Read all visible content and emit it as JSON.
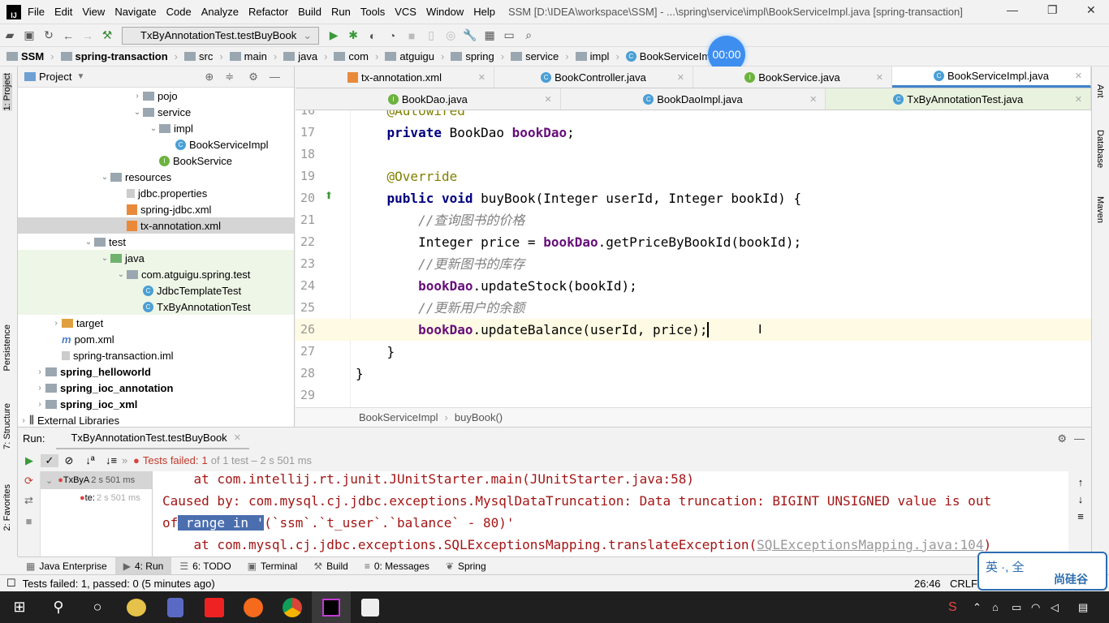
{
  "window": {
    "title": "SSM [D:\\IDEA\\workspace\\SSM] - ...\\spring\\service\\impl\\BookServiceImpl.java [spring-transaction]"
  },
  "menu": [
    "File",
    "Edit",
    "View",
    "Navigate",
    "Code",
    "Analyze",
    "Refactor",
    "Build",
    "Run",
    "Tools",
    "VCS",
    "Window",
    "Help"
  ],
  "toolbar": {
    "run_config": "TxByAnnotationTest.testBuyBook"
  },
  "breadcrumb": [
    "SSM",
    "spring-transaction",
    "src",
    "main",
    "java",
    "com",
    "atguigu",
    "spring",
    "service",
    "impl",
    "BookServiceImpl"
  ],
  "timer": "00:00",
  "left_stripe": [
    "1: Project",
    "Persistence",
    "7: Structure",
    "2: Favorites"
  ],
  "right_stripe": [
    "Ant",
    "Database",
    "Maven"
  ],
  "project": {
    "title": "Project",
    "tree": [
      {
        "label": "pojo",
        "indent": 7,
        "arrow": ">",
        "icon": "folder"
      },
      {
        "label": "service",
        "indent": 7,
        "arrow": "v",
        "icon": "folder"
      },
      {
        "label": "impl",
        "indent": 8,
        "arrow": "v",
        "icon": "folder"
      },
      {
        "label": "BookServiceImpl",
        "indent": 9,
        "arrow": "",
        "icon": "class"
      },
      {
        "label": "BookService",
        "indent": 8,
        "arrow": "",
        "icon": "interface"
      },
      {
        "label": "resources",
        "indent": 5,
        "arrow": "v",
        "icon": "folder"
      },
      {
        "label": "jdbc.properties",
        "indent": 6,
        "arrow": "",
        "icon": "file"
      },
      {
        "label": "spring-jdbc.xml",
        "indent": 6,
        "arrow": "",
        "icon": "xml"
      },
      {
        "label": "tx-annotation.xml",
        "indent": 6,
        "arrow": "",
        "icon": "xml",
        "selected": true
      },
      {
        "label": "test",
        "indent": 4,
        "arrow": "v",
        "icon": "folder"
      },
      {
        "label": "java",
        "indent": 5,
        "arrow": "v",
        "icon": "folder-green",
        "test": true
      },
      {
        "label": "com.atguigu.spring.test",
        "indent": 6,
        "arrow": "v",
        "icon": "folder",
        "test": true
      },
      {
        "label": "JdbcTemplateTest",
        "indent": 7,
        "arrow": "",
        "icon": "class",
        "test": true
      },
      {
        "label": "TxByAnnotationTest",
        "indent": 7,
        "arrow": "",
        "icon": "class",
        "test": true
      },
      {
        "label": "target",
        "indent": 2,
        "arrow": ">",
        "icon": "folder-orange"
      },
      {
        "label": "pom.xml",
        "indent": 2,
        "arrow": "",
        "icon": "maven"
      },
      {
        "label": "spring-transaction.iml",
        "indent": 2,
        "arrow": "",
        "icon": "file"
      },
      {
        "label": "spring_helloworld",
        "indent": 1,
        "arrow": ">",
        "icon": "folder",
        "bold": true
      },
      {
        "label": "spring_ioc_annotation",
        "indent": 1,
        "arrow": ">",
        "icon": "folder",
        "bold": true
      },
      {
        "label": "spring_ioc_xml",
        "indent": 1,
        "arrow": ">",
        "icon": "folder",
        "bold": true
      },
      {
        "label": "External Libraries",
        "indent": 0,
        "arrow": ">",
        "icon": "library"
      }
    ]
  },
  "tabs_row1": [
    {
      "label": "tx-annotation.xml",
      "icon": "xml"
    },
    {
      "label": "BookController.java",
      "icon": "class"
    },
    {
      "label": "BookService.java",
      "icon": "interface"
    },
    {
      "label": "BookServiceImpl.java",
      "icon": "class",
      "active": true
    }
  ],
  "tabs_row2": [
    {
      "label": "BookDao.java",
      "icon": "interface"
    },
    {
      "label": "BookDaoImpl.java",
      "icon": "class"
    },
    {
      "label": "TxByAnnotationTest.java",
      "icon": "class",
      "active": true
    }
  ],
  "editor": {
    "lines": [
      {
        "n": "16",
        "html": "    <span class='an'>@Autowired</span>"
      },
      {
        "n": "17",
        "html": "    <span class='kw'>private</span> BookDao <span class='fld'>bookDao</span>;"
      },
      {
        "n": "18",
        "html": ""
      },
      {
        "n": "19",
        "html": "    <span class='an'>@Override</span>"
      },
      {
        "n": "20",
        "html": "    <span class='kw'>public void</span> buyBook(Integer userId, Integer bookId) {"
      },
      {
        "n": "21",
        "html": "        <span class='cm'>//查询图书的价格</span>"
      },
      {
        "n": "22",
        "html": "        Integer price = <span class='fld'>bookDao</span>.getPriceByBookId(bookId);"
      },
      {
        "n": "23",
        "html": "        <span class='cm'>//更新图书的库存</span>"
      },
      {
        "n": "24",
        "html": "        <span class='fld'>bookDao</span>.updateStock(bookId);"
      },
      {
        "n": "25",
        "html": "        <span class='cm'>//更新用户的余额</span>"
      },
      {
        "n": "26",
        "html": "        <span class='fld'>bookDao</span>.updateBalance(userId, price);",
        "current": true
      },
      {
        "n": "27",
        "html": "    }"
      },
      {
        "n": "28",
        "html": "}"
      },
      {
        "n": "29",
        "html": ""
      }
    ],
    "breadcrumb": [
      "BookServiceImpl",
      "buyBook()"
    ]
  },
  "run": {
    "label": "Run:",
    "tab": "TxByAnnotationTest.testBuyBook",
    "status_prefix": "Tests failed:",
    "status_count": "1",
    "status_suffix": "of 1 test – 2 s 501 ms",
    "tree": [
      {
        "label": "TxByA",
        "time": "2 s 501 ms"
      },
      {
        "label": "te:",
        "time": "2 s 501 ms"
      }
    ],
    "console": {
      "l1": "    at com.intellij.rt.junit.JUnitStarter.main(JUnitStarter.java:58)",
      "l2": "Caused by: com.mysql.cj.jdbc.exceptions.MysqlDataTruncation: Data truncation: BIGINT UNSIGNED value is out",
      "l3a": "of",
      "l3sel": " range in '",
      "l3b": "(`ssm`.`t_user`.`balance` - 80)'",
      "l4a": "    at com.mysql.cj.jdbc.exceptions.SQLExceptionsMapping.translateException(",
      "l4link": "SQLExceptionsMapping.java:104",
      "l4b": ")"
    }
  },
  "bottom_tabs": [
    "Java Enterprise",
    "4: Run",
    "6: TODO",
    "Terminal",
    "Build",
    "0: Messages",
    "Spring"
  ],
  "status": {
    "text": "Tests failed: 1, passed: 0 (5 minutes ago)",
    "position": "26:46",
    "line_sep": "CRLF"
  },
  "ime": {
    "text": "英 ·, 全",
    "brand": "尚硅谷"
  }
}
